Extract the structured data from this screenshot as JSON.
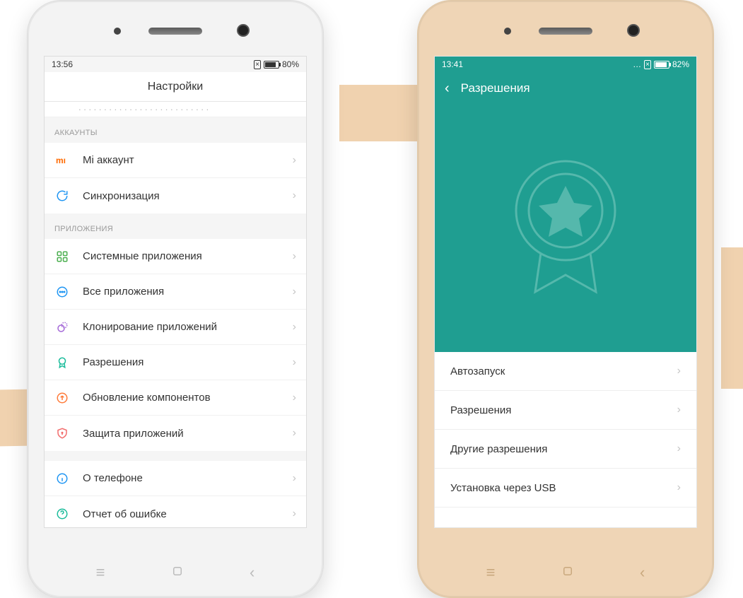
{
  "left_phone": {
    "status": {
      "time": "13:56",
      "battery_pct": "80%"
    },
    "title": "Настройки",
    "section_accounts": "АККАУНТЫ",
    "section_apps": "ПРИЛОЖЕНИЯ",
    "rows": {
      "mi_account": "Mi аккаунт",
      "sync": "Синхронизация",
      "system_apps": "Системные приложения",
      "all_apps": "Все приложения",
      "clone_apps": "Клонирование приложений",
      "permissions": "Разрешения",
      "component_update": "Обновление компонентов",
      "app_protection": "Защита приложений",
      "about_phone": "О телефоне",
      "bug_report": "Отчет об ошибке"
    }
  },
  "right_phone": {
    "status": {
      "time": "13:41",
      "battery_pct": "82%"
    },
    "title": "Разрешения",
    "rows": {
      "autostart": "Автозапуск",
      "permissions": "Разрешения",
      "other_permissions": "Другие разрешения",
      "usb_install": "Установка через USB"
    }
  },
  "colors": {
    "teal": "#1f9e91",
    "mi_orange": "#ff6a00",
    "icon_blue": "#2096f3",
    "icon_green": "#4caf50",
    "icon_teal2": "#1bbc9b",
    "icon_purple": "#a56ad8",
    "icon_orange": "#ff7b3a",
    "icon_red": "#f26d6d"
  }
}
